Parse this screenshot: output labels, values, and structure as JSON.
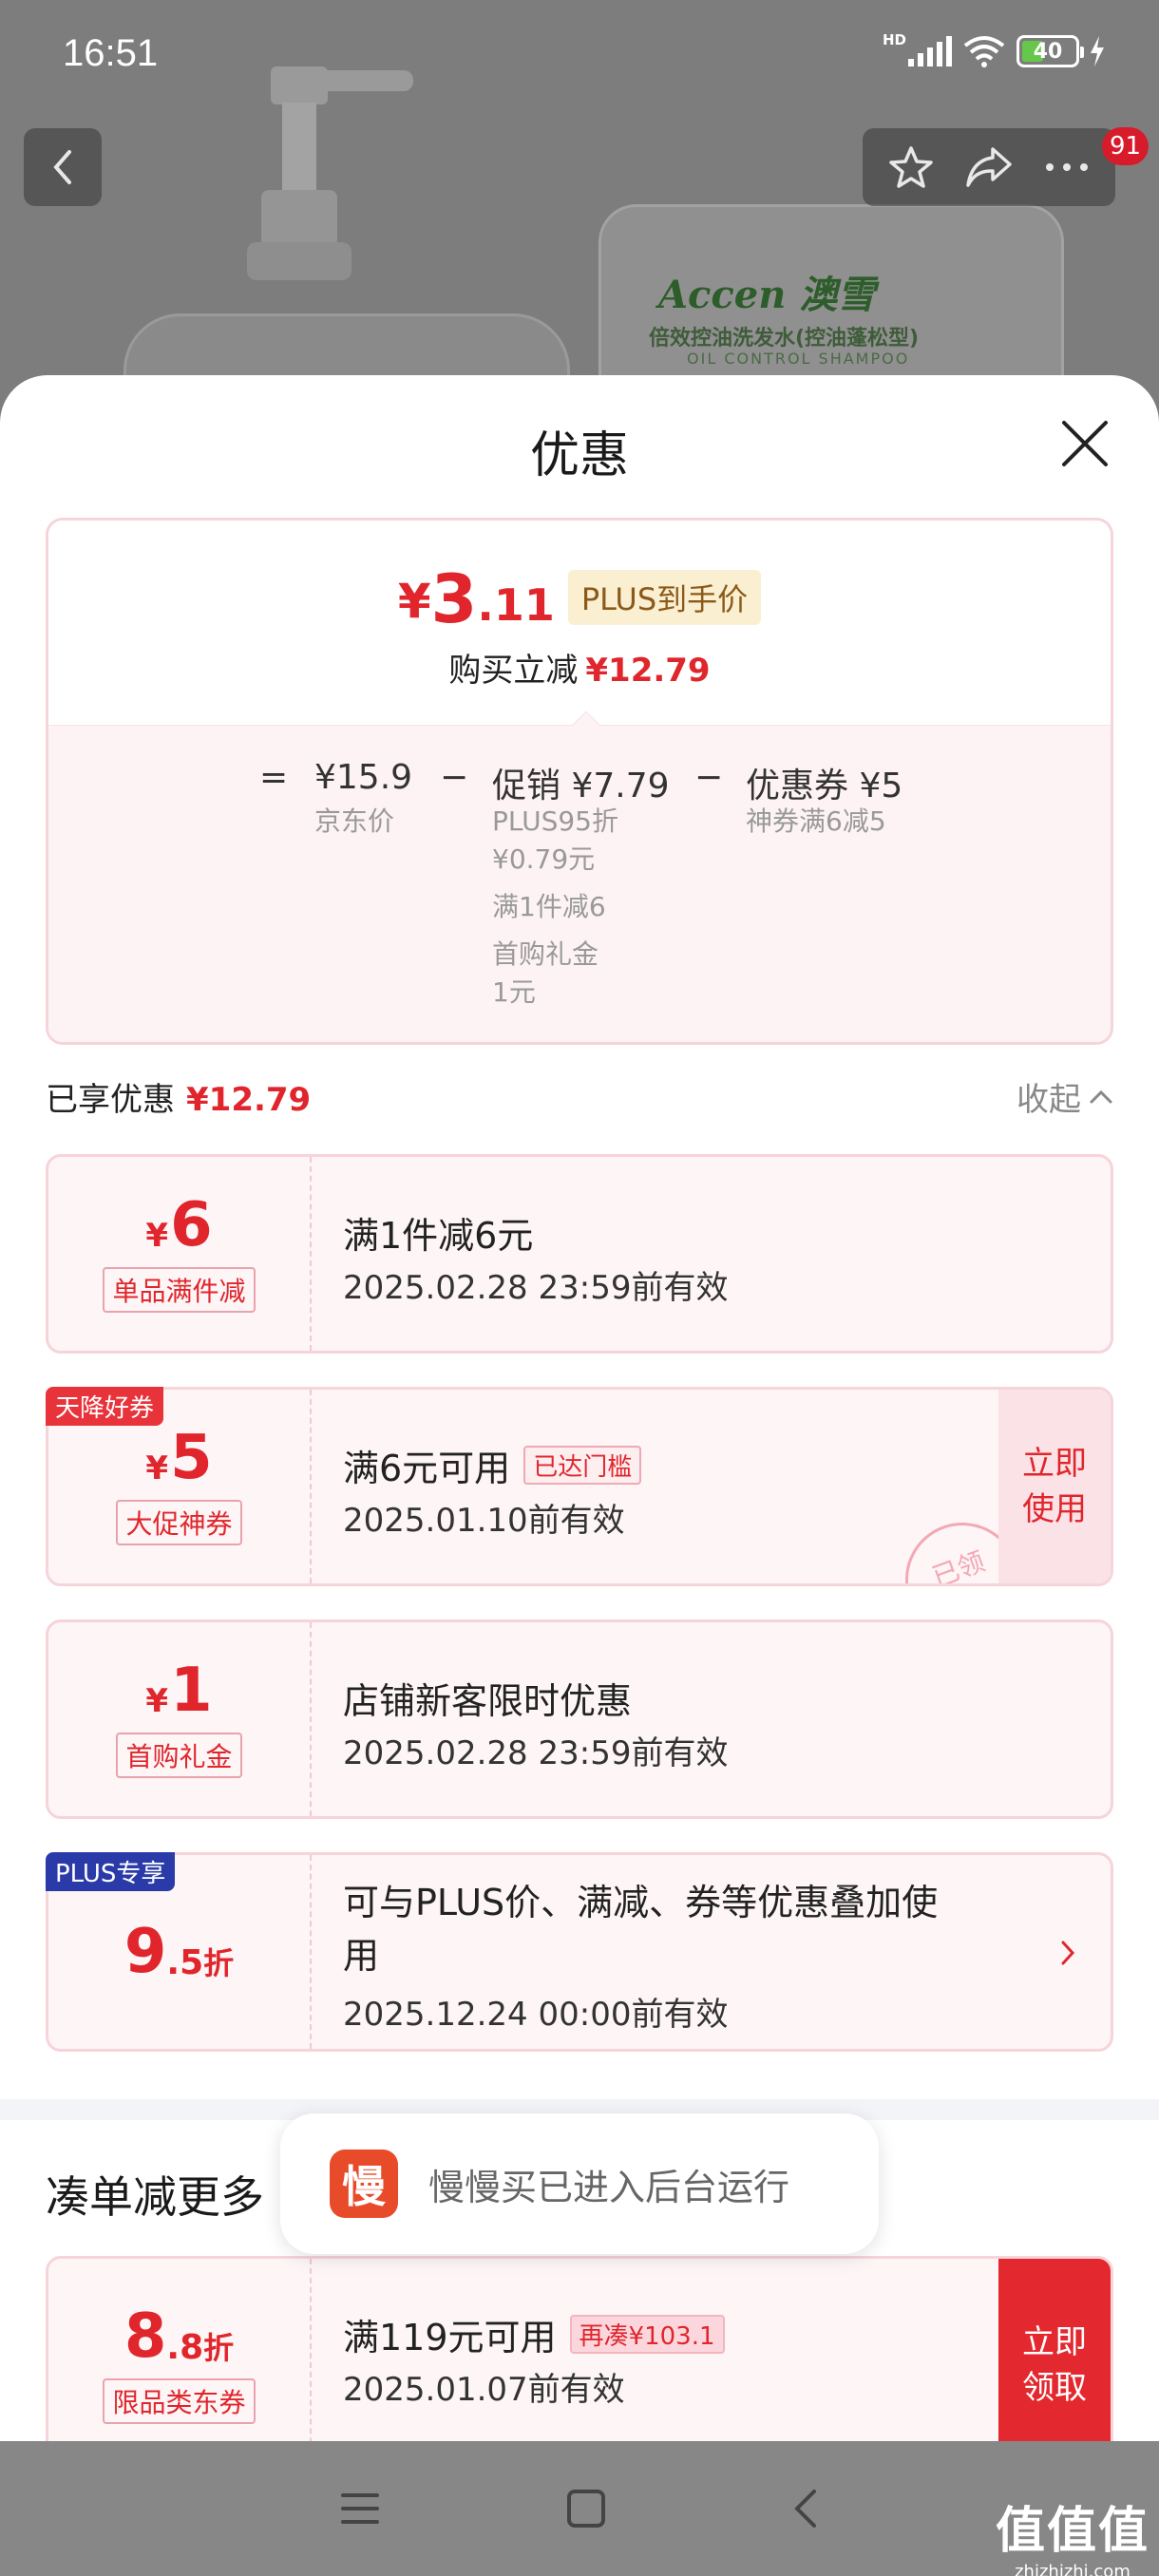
{
  "status_bar": {
    "time": "16:51",
    "network": "HD",
    "battery": "40"
  },
  "nav": {
    "badge": "91"
  },
  "background": {
    "brand": "Accen 澳雪",
    "product_line": "倍效控油洗发水(控油蓬松型)",
    "product_en": "OIL CONTROL SHAMPOO"
  },
  "sheet": {
    "title": "优惠",
    "summary": {
      "price_yen": "¥",
      "price_int": "3",
      "price_dec": ".11",
      "plus_tag": "PLUS到手价",
      "instant_label": "购买立减",
      "instant_value": "¥12.79",
      "equals": "=",
      "minus": "−",
      "jd_price": "¥15.9",
      "jd_label": "京东价",
      "promo_title": "促销 ¥7.79",
      "promo_lines": [
        "PLUS95折",
        "¥0.79元",
        "满1件减6",
        "首购礼金",
        "1元"
      ],
      "coupon_title": "优惠券 ¥5",
      "coupon_sub": "神券满6减5"
    },
    "enjoyed": {
      "label": "已享优惠",
      "value": "¥12.79",
      "collapse": "收起"
    },
    "coupons": [
      {
        "yen": "¥",
        "amount": "6",
        "label": "单品满件减",
        "title": "满1件减6元",
        "date": "2025.02.28 23:59前有效"
      },
      {
        "corner": "天降好券",
        "yen": "¥",
        "amount": "5",
        "label": "大促神券",
        "title": "满6元可用",
        "tag": "已达门槛",
        "date": "2025.01.10前有效",
        "button_lines": [
          "立即",
          "使用"
        ],
        "stamp": "已领"
      },
      {
        "yen": "¥",
        "amount": "1",
        "label": "首购礼金",
        "title": "店铺新客限时优惠",
        "date": "2025.02.28 23:59前有效"
      },
      {
        "corner": "PLUS专享",
        "amount": "9",
        "amount_small": ".5",
        "unit": "折",
        "title_line1": "可与PLUS价、满减、券等优惠叠加使",
        "title_line2": "用",
        "date": "2025.12.24 00:00前有效"
      }
    ],
    "more": {
      "title": "凑单减更多",
      "coupon": {
        "amount": "8",
        "amount_small": ".8",
        "unit": "折",
        "label": "限品类东券",
        "title": "满119元可用",
        "tag": "再凑¥103.1",
        "date": "2025.01.07前有效",
        "button_lines": [
          "立即",
          "领取"
        ]
      }
    }
  },
  "toast": {
    "icon_char": "慢",
    "text": "慢慢买已进入后台运行"
  },
  "watermark": {
    "main": "值值值",
    "sub": "zhizhizhi.com"
  },
  "colors": {
    "accent": "#e0262c",
    "plus_blue": "#2a3aa8",
    "corner_red": "#e8333b"
  }
}
